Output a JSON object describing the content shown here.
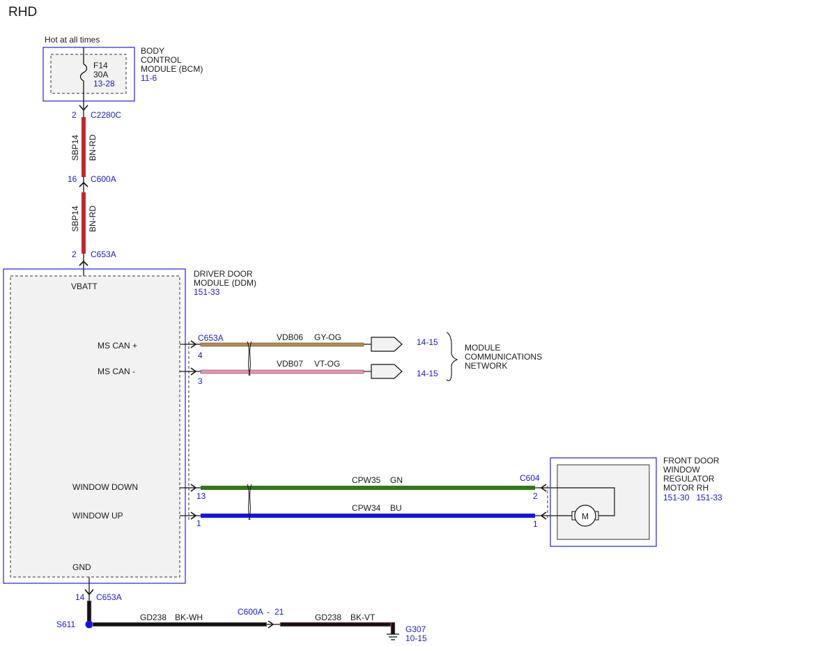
{
  "title": "RHD",
  "colors": {
    "ref_blue": "#1a1acc",
    "module_border": "#3333dd",
    "bn_rd": "#c0282c",
    "gy_og": "#b9894f",
    "vt_og": "#e892b8",
    "gn": "#2f7a16",
    "bu": "#1515e0",
    "bk": "#111111",
    "module_fill": "#f2f2f2"
  },
  "power": {
    "label": "Hot at all times"
  },
  "bcm": {
    "name_lines": [
      "BODY",
      "CONTROL",
      "MODULE (BCM)"
    ],
    "ref": "11-6",
    "fuse": {
      "id": "F14",
      "rating": "30A",
      "ref": "13-28"
    }
  },
  "c2280c": {
    "pin": "2",
    "id": "C2280C"
  },
  "wire_upper": {
    "circuit": "SBP14",
    "color": "BN-RD"
  },
  "c600a_top": {
    "pin": "16",
    "id": "C600A"
  },
  "wire_lower": {
    "circuit": "SBP14",
    "color": "BN-RD"
  },
  "c653a_top": {
    "pin": "2",
    "id": "C653A"
  },
  "ddm": {
    "name_lines": [
      "DRIVER DOOR",
      "MODULE (DDM)"
    ],
    "ref": "151-33",
    "pins": {
      "vbatt": "VBATT",
      "ms_can_plus": "MS CAN +",
      "ms_can_minus": "MS CAN -",
      "window_down": "WINDOW DOWN",
      "window_up": "WINDOW UP",
      "gnd": "GND"
    }
  },
  "can": {
    "connector": "C653A",
    "plus": {
      "pin": "4",
      "circuit": "VDB06",
      "color": "GY-OG",
      "ref": "14-15"
    },
    "minus": {
      "pin": "3",
      "circuit": "VDB07",
      "color": "VT-OG",
      "ref": "14-15"
    },
    "network_lines": [
      "MODULE",
      "COMMUNICATIONS",
      "NETWORK"
    ]
  },
  "window": {
    "down": {
      "pin": "13",
      "circuit": "CPW35",
      "color": "GN",
      "motor_pin": "2"
    },
    "up": {
      "pin": "1",
      "circuit": "CPW34",
      "color": "BU",
      "motor_pin": "1"
    },
    "motor_connector": "C604"
  },
  "motor": {
    "name_lines": [
      "FRONT DOOR",
      "WINDOW",
      "REGULATOR",
      "MOTOR RH"
    ],
    "refs": "151-30   151-33",
    "symbol": "M"
  },
  "ground": {
    "ddm_pin": "14",
    "ddm_connector": "C653A",
    "splice": "S611",
    "wire1": {
      "circuit": "GD238",
      "color": "BK-WH"
    },
    "inline_connector": "C600A",
    "inline_sep": "-",
    "inline_pin": "21",
    "wire2": {
      "circuit": "GD238",
      "color": "BK-VT"
    },
    "ground_point": "G307",
    "ground_ref": "10-15"
  }
}
